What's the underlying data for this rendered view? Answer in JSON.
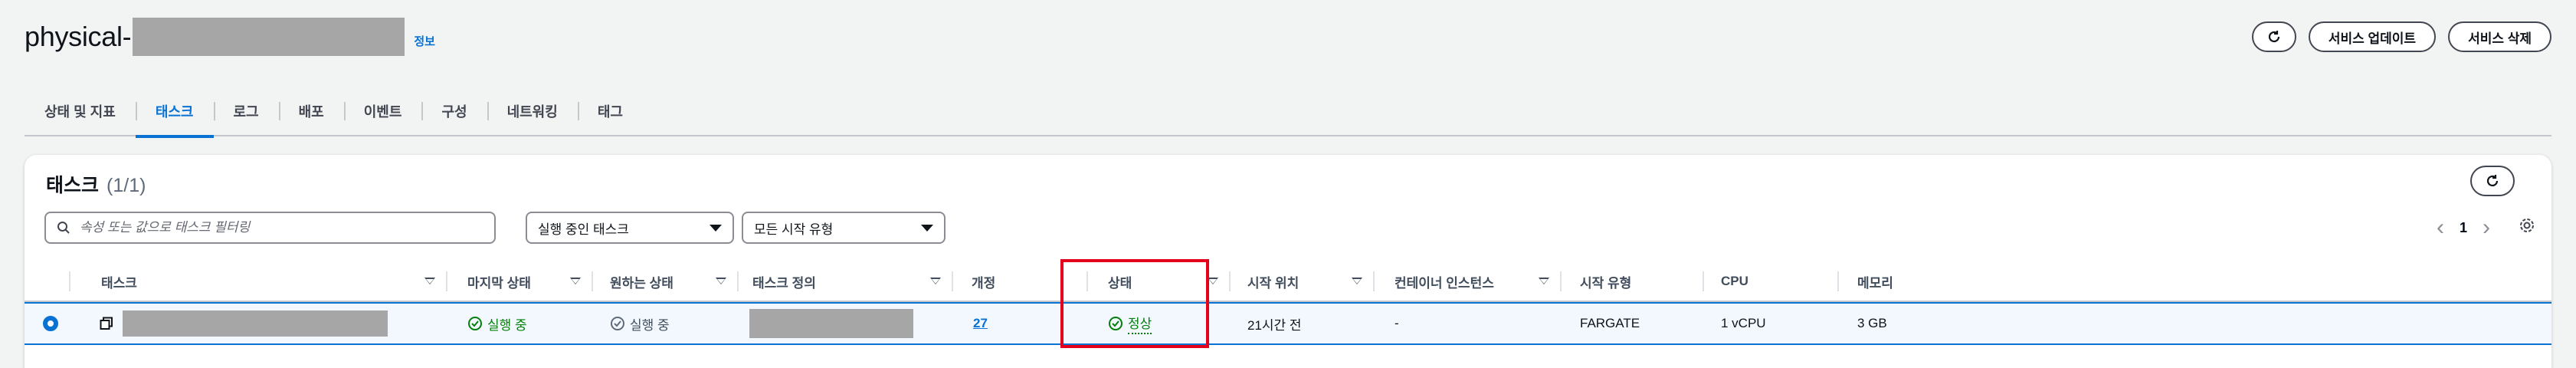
{
  "page": {
    "title_prefix": "physical-",
    "info_link": "정보",
    "actions": {
      "update": "서비스 업데이트",
      "delete": "서비스 삭제"
    }
  },
  "tabs": [
    {
      "label": "상태 및 지표",
      "active": false
    },
    {
      "label": "태스크",
      "active": true
    },
    {
      "label": "로그",
      "active": false
    },
    {
      "label": "배포",
      "active": false
    },
    {
      "label": "이벤트",
      "active": false
    },
    {
      "label": "구성",
      "active": false
    },
    {
      "label": "네트워킹",
      "active": false
    },
    {
      "label": "태그",
      "active": false
    }
  ],
  "tasks_panel": {
    "title": "태스크",
    "count": "(1/1)",
    "filter_placeholder": "속성 또는 값으로 태스크 필터링",
    "status_select": "실행 중인 태스크",
    "launch_select": "모든 시작 유형",
    "page_number": "1"
  },
  "table": {
    "columns": [
      "태스크",
      "마지막 상태",
      "원하는 상태",
      "태스크 정의",
      "개정",
      "상태",
      "시작 위치",
      "컨테이너 인스턴스",
      "시작 유형",
      "CPU",
      "메모리"
    ],
    "rows": [
      {
        "last_status": "실행 중",
        "desired_status": "실행 중",
        "revision": "27",
        "health": "정상",
        "started_at": "21시간 전",
        "container_instance": "-",
        "launch_type": "FARGATE",
        "cpu": "1 vCPU",
        "memory": "3 GB"
      }
    ]
  },
  "colors": {
    "accent": "#0972d3",
    "success": "#037f0c",
    "highlight": "#e3001b"
  }
}
